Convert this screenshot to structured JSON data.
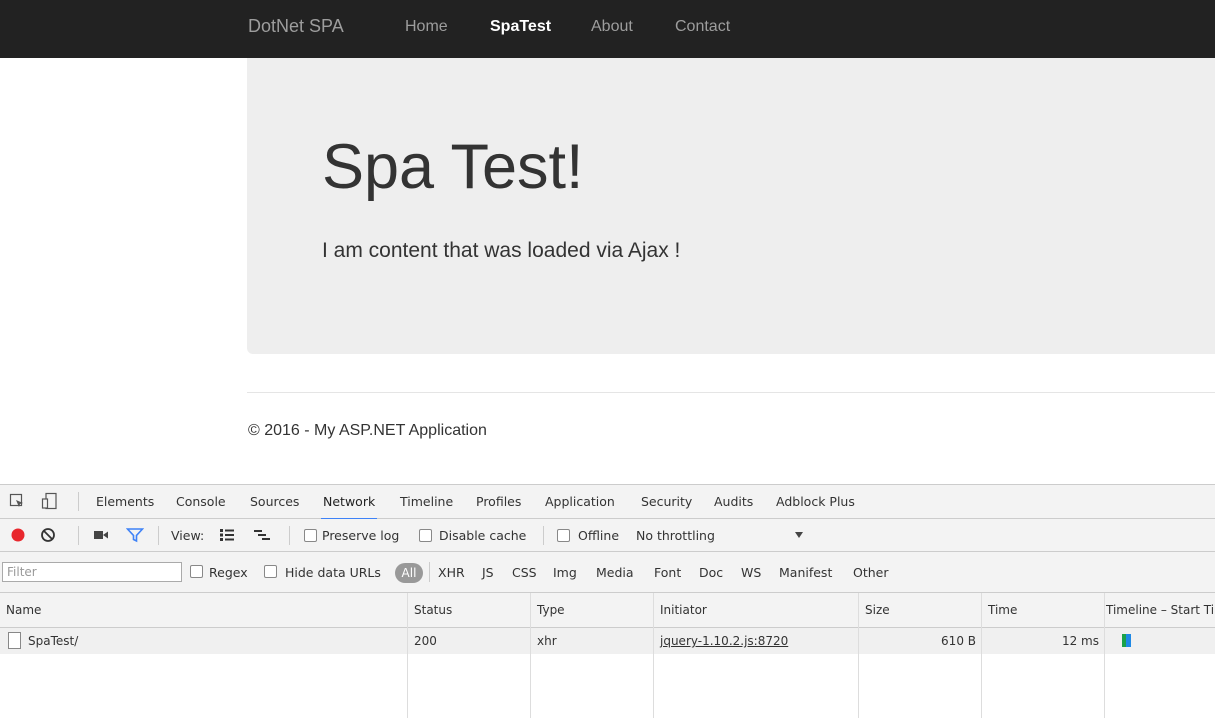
{
  "navbar": {
    "brand": "DotNet SPA",
    "links": [
      "Home",
      "SpaTest",
      "About",
      "Contact"
    ],
    "active": "SpaTest"
  },
  "jumbotron": {
    "title": "Spa Test!",
    "text": "I am content that was loaded via Ajax !"
  },
  "footer": {
    "text": "© 2016 - My ASP.NET Application"
  },
  "devtools": {
    "tabs": [
      "Elements",
      "Console",
      "Sources",
      "Network",
      "Timeline",
      "Profiles",
      "Application",
      "Security",
      "Audits",
      "Adblock Plus"
    ],
    "active_tab": "Network",
    "toolbar": {
      "view_label": "View:",
      "preserve_log": "Preserve log",
      "disable_cache": "Disable cache",
      "offline": "Offline",
      "throttling": "No throttling"
    },
    "filter": {
      "placeholder": "Filter",
      "regex": "Regex",
      "hide_data_urls": "Hide data URLs",
      "all": "All",
      "types": [
        "XHR",
        "JS",
        "CSS",
        "Img",
        "Media",
        "Font",
        "Doc",
        "WS",
        "Manifest",
        "Other"
      ]
    },
    "table": {
      "columns": [
        "Name",
        "Status",
        "Type",
        "Initiator",
        "Size",
        "Time",
        "Timeline – Start Ti"
      ],
      "rows": [
        {
          "name": "SpaTest/",
          "status": "200",
          "type": "xhr",
          "initiator": "jquery-1.10.2.js:8720",
          "size": "610 B",
          "time": "12 ms"
        }
      ]
    },
    "colors": {
      "record": "#e8272d",
      "accent": "#3e82f7",
      "timeline_wait": "#1ba24a",
      "timeline_download": "#1e88e5"
    }
  }
}
